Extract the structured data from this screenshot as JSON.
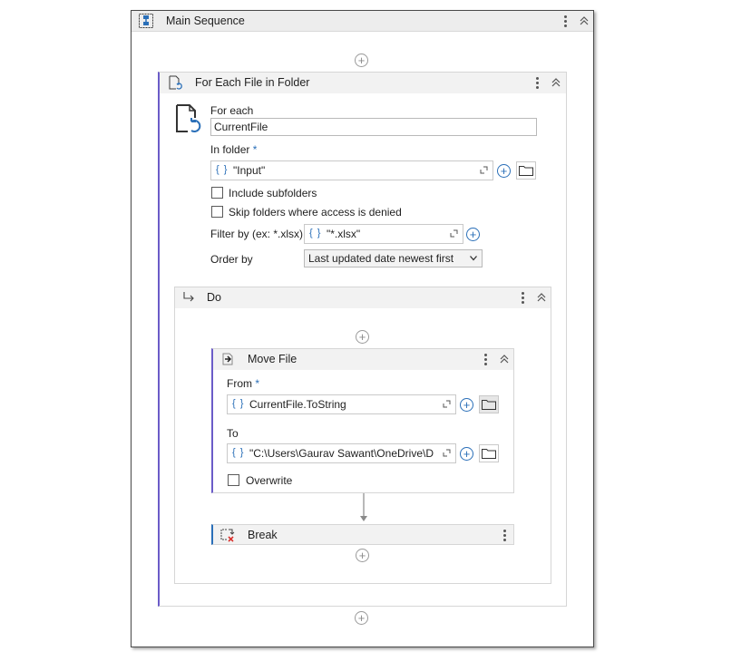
{
  "main_sequence": {
    "title": "Main Sequence"
  },
  "for_each": {
    "title": "For Each File in Folder",
    "for_each_label": "For each",
    "for_each_value": "CurrentFile",
    "in_folder_label": "In folder",
    "required_mark": "*",
    "in_folder_brace": "{ }",
    "in_folder_value": "\"Input\"",
    "include_subfolders_label": "Include subfolders",
    "skip_folders_label": "Skip folders where access is denied",
    "filter_label": "Filter by (ex: *.xlsx)",
    "filter_brace": "{ }",
    "filter_value": "\"*.xlsx\"",
    "order_label": "Order by",
    "order_value": "Last updated date newest first"
  },
  "do_block": {
    "title": "Do"
  },
  "move_file": {
    "title": "Move File",
    "from_label": "From",
    "required_mark": "*",
    "from_brace": "{ }",
    "from_value": "CurrentFile.ToString",
    "to_label": "To",
    "to_brace": "{ }",
    "to_value": "\"C:\\Users\\Gaurav Sawant\\OneDrive\\De",
    "overwrite_label": "Overwrite"
  },
  "break_activity": {
    "title": "Break"
  },
  "icons": {
    "sequence": "sequence-icon",
    "for_each": "for-each-file-icon",
    "do": "do-arrow-icon",
    "move": "move-file-icon",
    "break": "break-icon",
    "folder": "folder-icon",
    "expand": "expand-editor-icon",
    "add": "plus-circle-icon"
  },
  "colors": {
    "accent": "#2a6fb8",
    "header_bg": "#ededed",
    "break_red": "#d9302c"
  }
}
